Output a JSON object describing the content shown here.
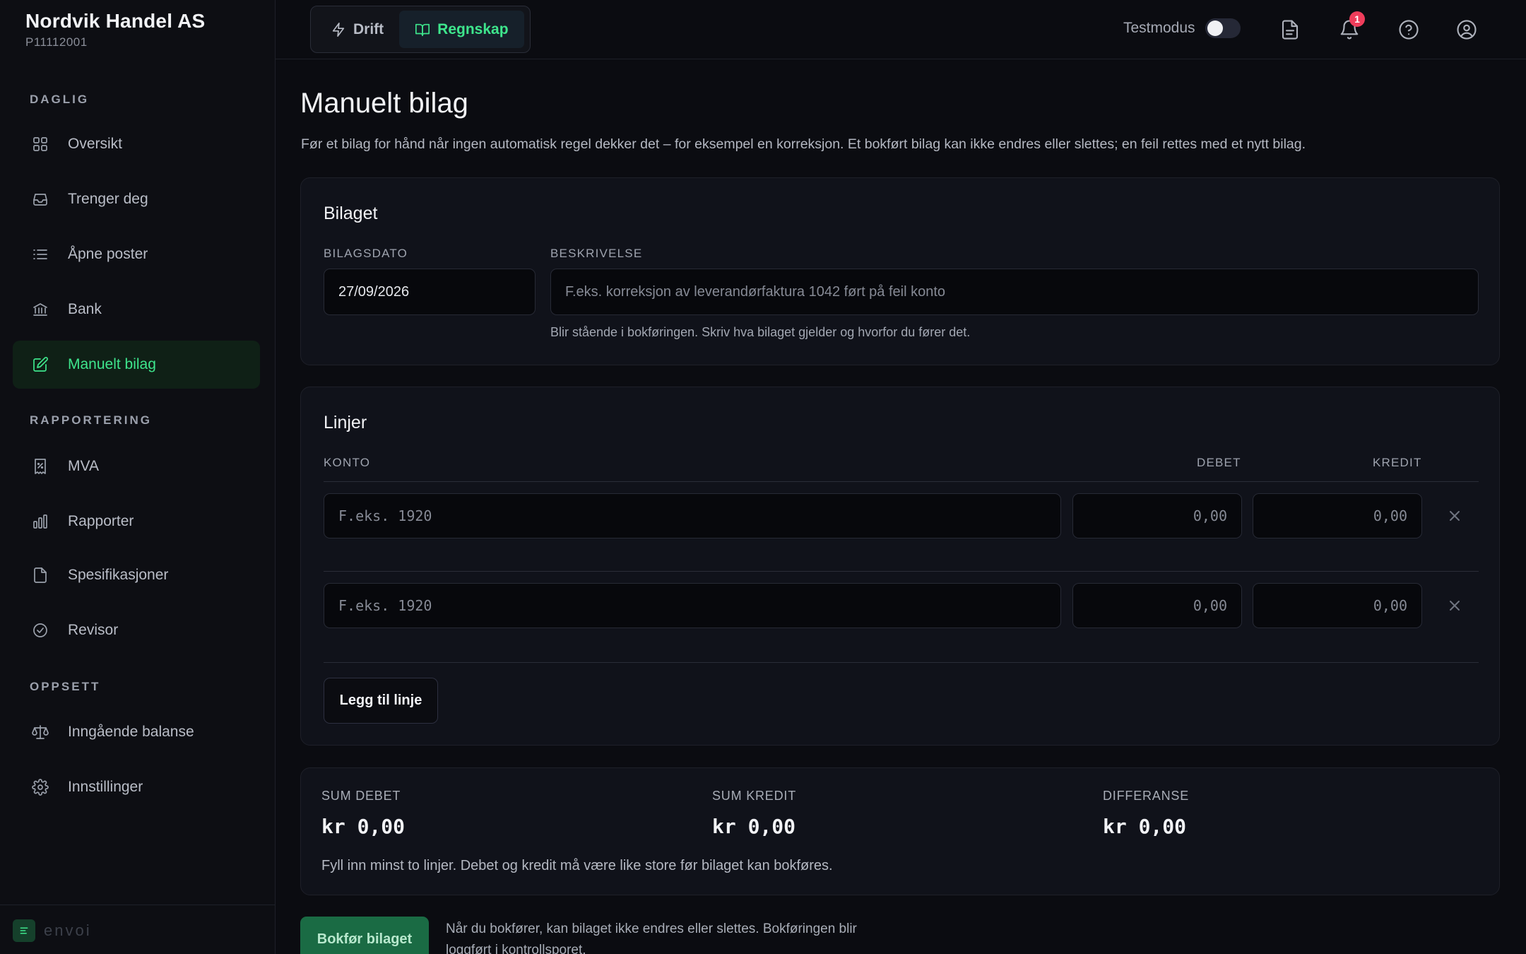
{
  "brand": {
    "name": "Nordvik Handel AS",
    "id": "P11112001"
  },
  "sidebar": {
    "sections": [
      {
        "title": "DAGLIG"
      },
      {
        "title": "RAPPORTERING"
      },
      {
        "title": "OPPSETT"
      }
    ],
    "items": [
      {
        "label": "Oversikt",
        "icon": "grid-icon"
      },
      {
        "label": "Trenger deg",
        "icon": "inbox-icon"
      },
      {
        "label": "Åpne poster",
        "icon": "list-icon"
      },
      {
        "label": "Bank",
        "icon": "bank-icon"
      },
      {
        "label": "Manuelt bilag",
        "icon": "edit-icon",
        "active": true
      },
      {
        "label": "MVA",
        "icon": "receipt-percent-icon"
      },
      {
        "label": "Rapporter",
        "icon": "bar-chart-icon"
      },
      {
        "label": "Spesifikasjoner",
        "icon": "file-icon"
      },
      {
        "label": "Revisor",
        "icon": "check-circle-icon"
      },
      {
        "label": "Inngående balanse",
        "icon": "scale-icon"
      },
      {
        "label": "Innstillinger",
        "icon": "gear-icon"
      }
    ],
    "footer_logo": "envoi"
  },
  "topbar": {
    "tabs": [
      {
        "label": "Drift",
        "icon": "bolt-icon"
      },
      {
        "label": "Regnskap",
        "icon": "book-icon",
        "active": true
      }
    ],
    "testmodus_label": "Testmodus",
    "testmodus_on": false,
    "notification_count": "1"
  },
  "page": {
    "title": "Manuelt bilag",
    "description": "Før et bilag for hånd når ingen automatisk regel dekker det – for eksempel en korreksjon. Et bokført bilag kan ikke endres eller slettes; en feil rettes med et nytt bilag."
  },
  "bilaget": {
    "title": "Bilaget",
    "date_label": "BILAGSDATO",
    "date_value": "27/09/2026",
    "desc_label": "BESKRIVELSE",
    "desc_placeholder": "F.eks. korreksjon av leverandørfaktura 1042 ført på feil konto",
    "desc_hint": "Blir stående i bokføringen. Skriv hva bilaget gjelder og hvorfor du fører det."
  },
  "linjer": {
    "title": "Linjer",
    "col_konto": "KONTO",
    "col_debet": "DEBET",
    "col_kredit": "KREDIT",
    "rows": [
      {
        "konto_placeholder": "F.eks. 1920",
        "debet_placeholder": "0,00",
        "kredit_placeholder": "0,00"
      },
      {
        "konto_placeholder": "F.eks. 1920",
        "debet_placeholder": "0,00",
        "kredit_placeholder": "0,00"
      }
    ],
    "add_button": "Legg til linje"
  },
  "summary": {
    "sum_debet_label": "SUM DEBET",
    "sum_debet_value": "kr 0,00",
    "sum_kredit_label": "SUM KREDIT",
    "sum_kredit_value": "kr 0,00",
    "differanse_label": "DIFFERANSE",
    "differanse_value": "kr 0,00",
    "note": "Fyll inn minst to linjer. Debet og kredit må være like store før bilaget kan bokføres."
  },
  "actions": {
    "submit_label": "Bokfør bilaget",
    "submit_note": "Når du bokfører, kan bilaget ikke endres eller slettes. Bokføringen blir loggført i kontrollsporet."
  },
  "colors": {
    "accent": "#3ee58c",
    "background": "#0b0c11",
    "badge": "#ef3d5b"
  }
}
